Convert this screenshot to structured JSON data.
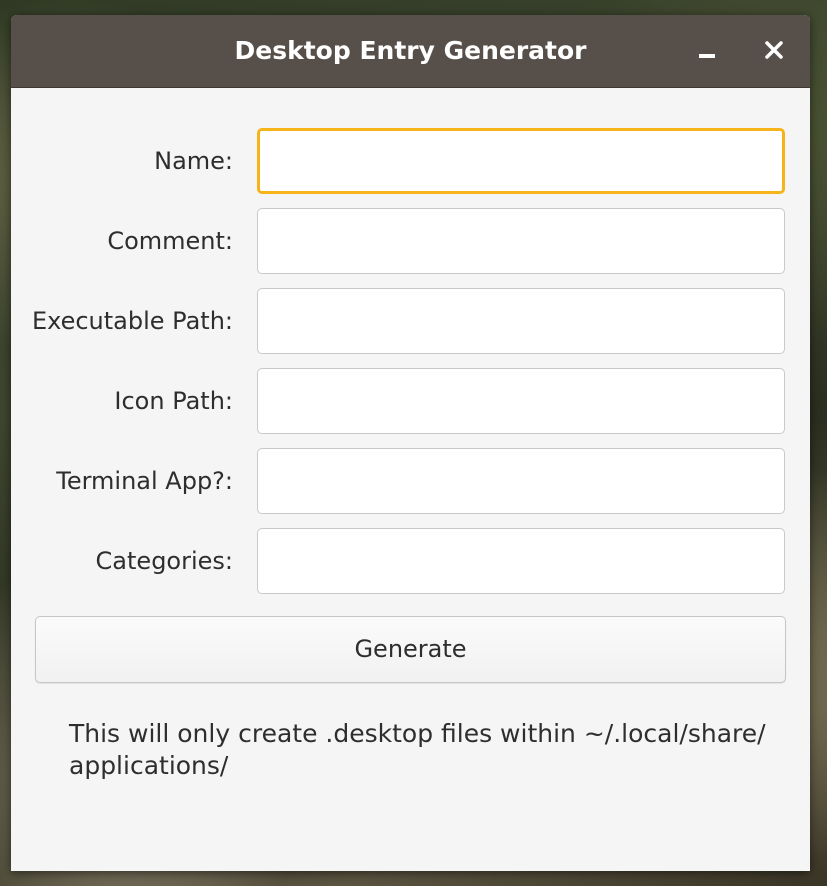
{
  "window": {
    "title": "Desktop Entry Generator"
  },
  "form": {
    "fields": [
      {
        "label": "Name:",
        "value": "",
        "focused": true
      },
      {
        "label": "Comment:",
        "value": ""
      },
      {
        "label": "Executable Path:",
        "value": ""
      },
      {
        "label": "Icon Path:",
        "value": ""
      },
      {
        "label": "Terminal App?:",
        "value": ""
      },
      {
        "label": "Categories:",
        "value": ""
      }
    ],
    "generate_label": "Generate"
  },
  "note": {
    "line1": "This will only create .desktop files within ~/.local/share/",
    "line2": "applications/"
  },
  "colors": {
    "titlebar": "#574f4a",
    "focus_border": "#f6b41a",
    "window_bg": "#f5f5f5"
  },
  "icons": {
    "minimize": "minimize-icon",
    "close": "close-icon"
  }
}
